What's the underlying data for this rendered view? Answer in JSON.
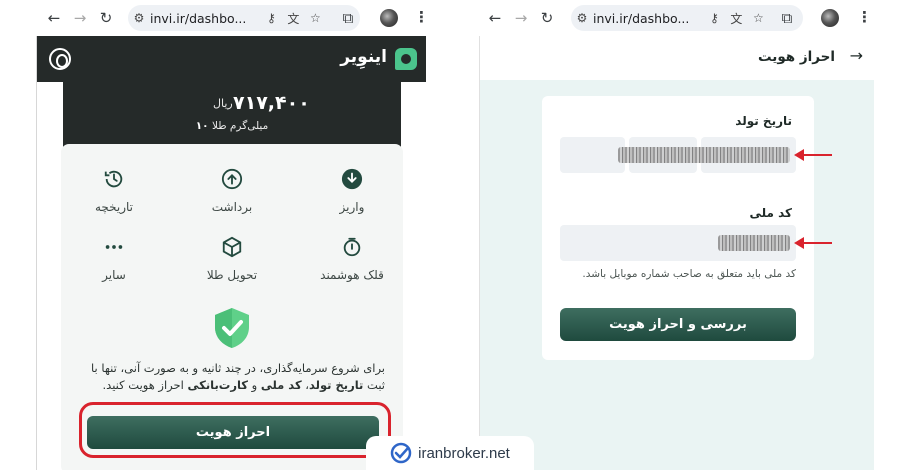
{
  "left_browser": {
    "url": "invi.ir/dashbo..."
  },
  "right_browser": {
    "url": "invi.ir/dashbo..."
  },
  "app": {
    "brand": "اینوِیر",
    "balance_amount": "۷۱۷,۴۰۰",
    "balance_unit": "ریال",
    "gold_amount": "۱۰",
    "gold_unit": "میلی‌گرم طلا"
  },
  "actions": [
    {
      "label": "واریز",
      "icon": "download-icon"
    },
    {
      "label": "برداشت",
      "icon": "upload-icon"
    },
    {
      "label": "تاریخچه",
      "icon": "history-icon"
    },
    {
      "label": "قلک هوشمند",
      "icon": "piggy-icon"
    },
    {
      "label": "تحویل طلا",
      "icon": "box-icon"
    },
    {
      "label": "سایر",
      "icon": "more-icon"
    }
  ],
  "kyc_prompt": {
    "line1": "برای شروع سرمایه‌گذاری، در چند ثانیه و به صورت آنی، تنها با",
    "line2_prefix": "ثبت",
    "birth": "تاریخ تولد",
    "comma": "،",
    "national": "کد ملی",
    "and": "و",
    "bank": "کارت‌بانکی",
    "suffix": "احراز هویت کنید.",
    "button": "احراز هویت"
  },
  "verify_page": {
    "title": "احراز هویت",
    "birth_label": "تاریخ تولد",
    "national_label": "کد ملی",
    "hint": "کد ملی باید متعلق به صاحب شماره موبایل باشد.",
    "submit": "بررسی و احراز هویت"
  },
  "watermark": "iranbroker.net",
  "colors": {
    "header_dark": "#252a29",
    "accent_green": "#1f4a3e",
    "highlight_red": "#d9232d"
  }
}
